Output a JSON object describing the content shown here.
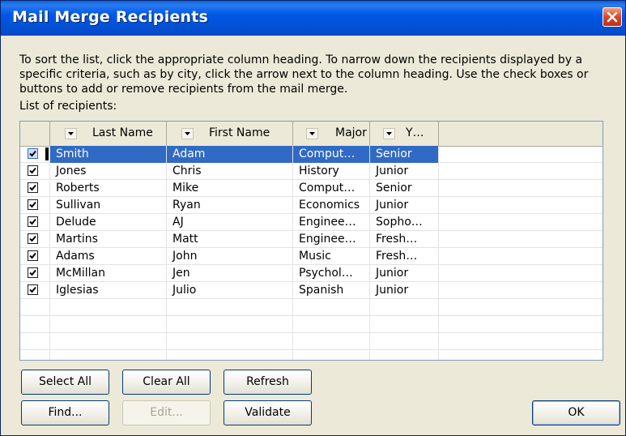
{
  "window": {
    "title": "Mail Merge Recipients"
  },
  "instructions": "To sort the list, click the appropriate column heading.  To narrow down the recipients displayed by a specific criteria, such as by city, click the arrow next to the column heading.  Use the check boxes or buttons to add or remove recipients from the mail merge.",
  "list_label": "List of recipients:",
  "columns": [
    "Last Name",
    "First Name",
    "Major",
    "Y…"
  ],
  "rows": [
    {
      "last": "Smith",
      "first": "Adam",
      "major": "Comput…",
      "year": "Senior",
      "checked": true,
      "selected": true
    },
    {
      "last": "Jones",
      "first": "Chris",
      "major": "History",
      "year": "Junior",
      "checked": true
    },
    {
      "last": "Roberts",
      "first": "Mike",
      "major": "Comput…",
      "year": "Senior",
      "checked": true
    },
    {
      "last": "Sullivan",
      "first": "Ryan",
      "major": "Economics",
      "year": "Junior",
      "checked": true
    },
    {
      "last": "Delude",
      "first": "AJ",
      "major": "Enginee…",
      "year": "Sopho…",
      "checked": true
    },
    {
      "last": "Martins",
      "first": "Matt",
      "major": "Enginee…",
      "year": "Fresh…",
      "checked": true
    },
    {
      "last": "Adams",
      "first": "John",
      "major": "Music",
      "year": "Fresh…",
      "checked": true
    },
    {
      "last": "McMillan",
      "first": "Jen",
      "major": "Psychol…",
      "year": "Junior",
      "checked": true
    },
    {
      "last": "Iglesias",
      "first": "Julio",
      "major": "Spanish",
      "year": "Junior",
      "checked": true
    }
  ],
  "buttons": {
    "select_all": "Select All",
    "clear_all": "Clear All",
    "refresh": "Refresh",
    "find": "Find...",
    "edit": "Edit...",
    "validate": "Validate",
    "ok": "OK"
  },
  "colors": {
    "titlebar": "#0058e6",
    "selection": "#316ac5",
    "dialog_bg": "#ece9d8",
    "close": "#d8482a"
  },
  "icons": {
    "close": "close-icon",
    "dropdown": "dropdown-arrow-icon",
    "check": "checkmark-icon"
  }
}
